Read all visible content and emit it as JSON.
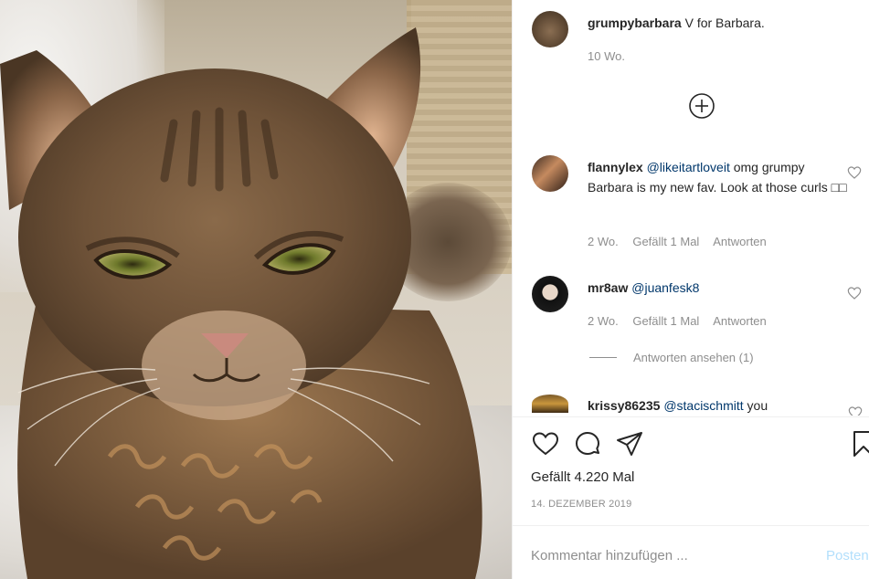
{
  "post": {
    "author": "grumpybarbara",
    "caption": "V for Barbara.",
    "time": "10 Wo."
  },
  "comments": [
    {
      "user": "flannylex",
      "mention": "@likeitartloveit",
      "text": "omg grumpy Barbara is my new fav. Look at those curls □□",
      "time": "2 Wo.",
      "likes": "Gefällt 1 Mal",
      "reply": "Antworten"
    },
    {
      "user": "mr8aw",
      "mention": "@juanfesk8",
      "text": "",
      "time": "2 Wo.",
      "likes": "Gefällt 1 Mal",
      "reply": "Antworten",
      "view_replies": "Antworten ansehen (1)"
    },
    {
      "user": "krissy86235",
      "mention": "@stacischmitt",
      "text": "you"
    }
  ],
  "likes_count": "Gefällt 4.220 Mal",
  "date": "14. DEZEMBER 2019",
  "comment_input": {
    "placeholder": "Kommentar hinzufügen ..."
  },
  "post_button": "Posten",
  "icons": {
    "like": "heart-icon",
    "comment": "speech-bubble-icon",
    "share": "paper-plane-icon",
    "save": "bookmark-icon",
    "load_more": "plus-circle-icon"
  }
}
